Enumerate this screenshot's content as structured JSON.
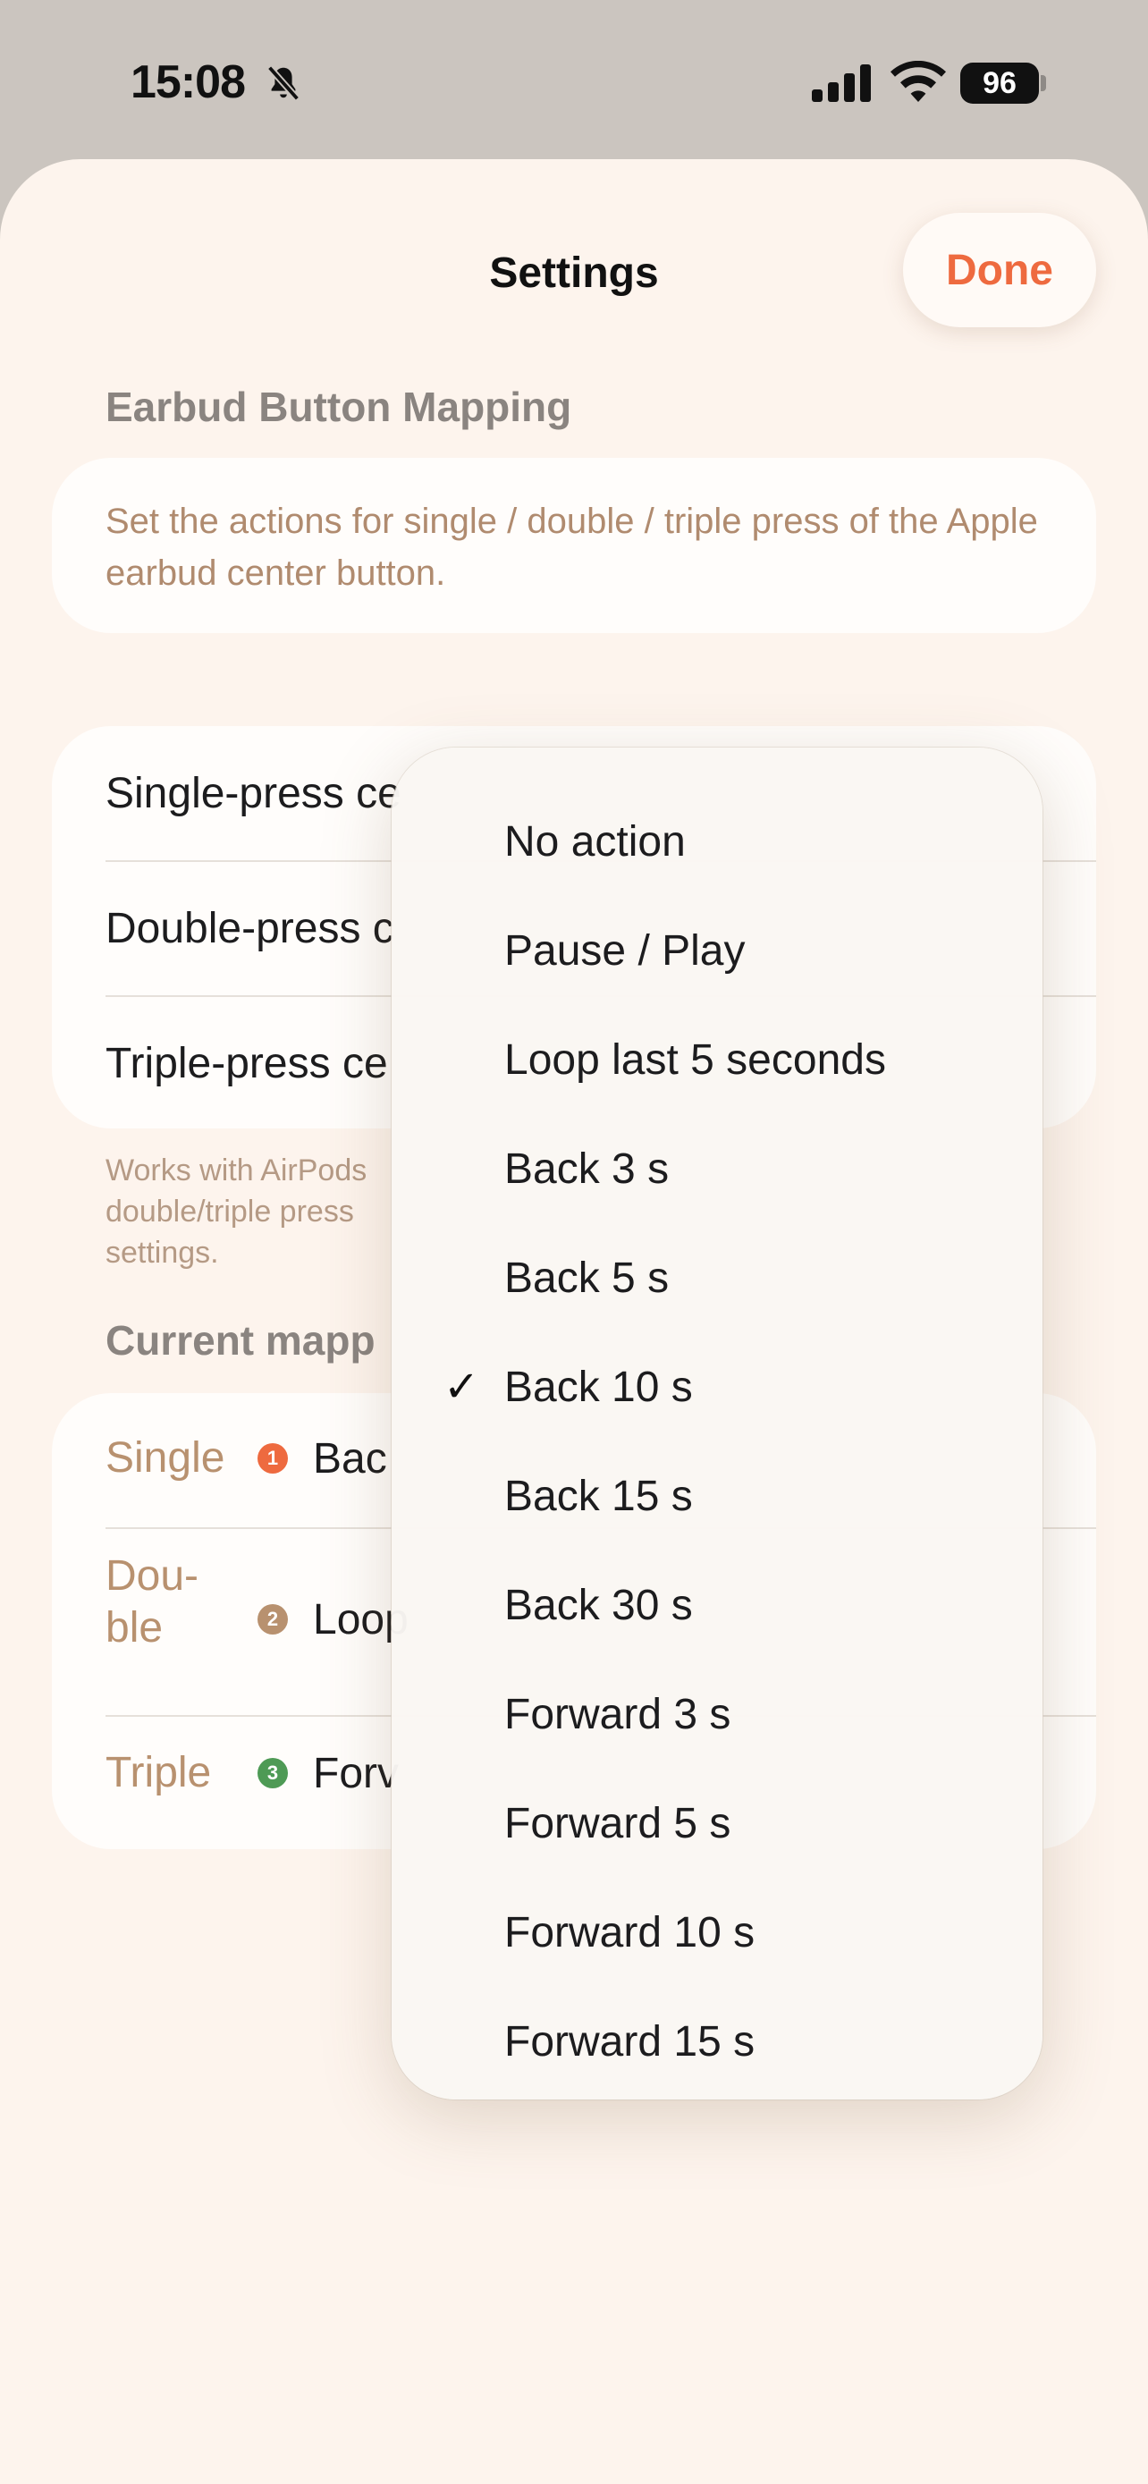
{
  "status_bar": {
    "time": "15:08",
    "battery": "96"
  },
  "header": {
    "title": "Settings",
    "done_label": "Done"
  },
  "sections": {
    "earbud_mapping_title": "Earbud Button Mapping",
    "earbud_mapping_info": "Set the actions for single / double / triple press of the Apple earbud center button.",
    "current_mapping_title": "Current mapp"
  },
  "press_rows": [
    {
      "label": "Single-press ce"
    },
    {
      "label": "Double-press c"
    },
    {
      "label": "Triple-press ce"
    }
  ],
  "footnote": "Works with AirPods\ndouble/triple press\nsettings.",
  "current_mapping": [
    {
      "label": "Single",
      "number": "1",
      "value": "Bac",
      "color": "#ee6a3f"
    },
    {
      "label": "Dou-\nble",
      "number": "2",
      "value": "Loop",
      "color": "#b8916f"
    },
    {
      "label": "Triple",
      "number": "3",
      "value": "Forv",
      "color": "#4e9a55"
    }
  ],
  "menu": {
    "selected": "Back 10 s",
    "check_glyph": "✓",
    "items": [
      "No action",
      "Pause / Play",
      "Loop last 5 seconds",
      "Back 3 s",
      "Back 5 s",
      "Back 10 s",
      "Back 15 s",
      "Back 30 s",
      "Forward 3 s",
      "Forward 5 s",
      "Forward 10 s",
      "Forward 15 s"
    ]
  }
}
